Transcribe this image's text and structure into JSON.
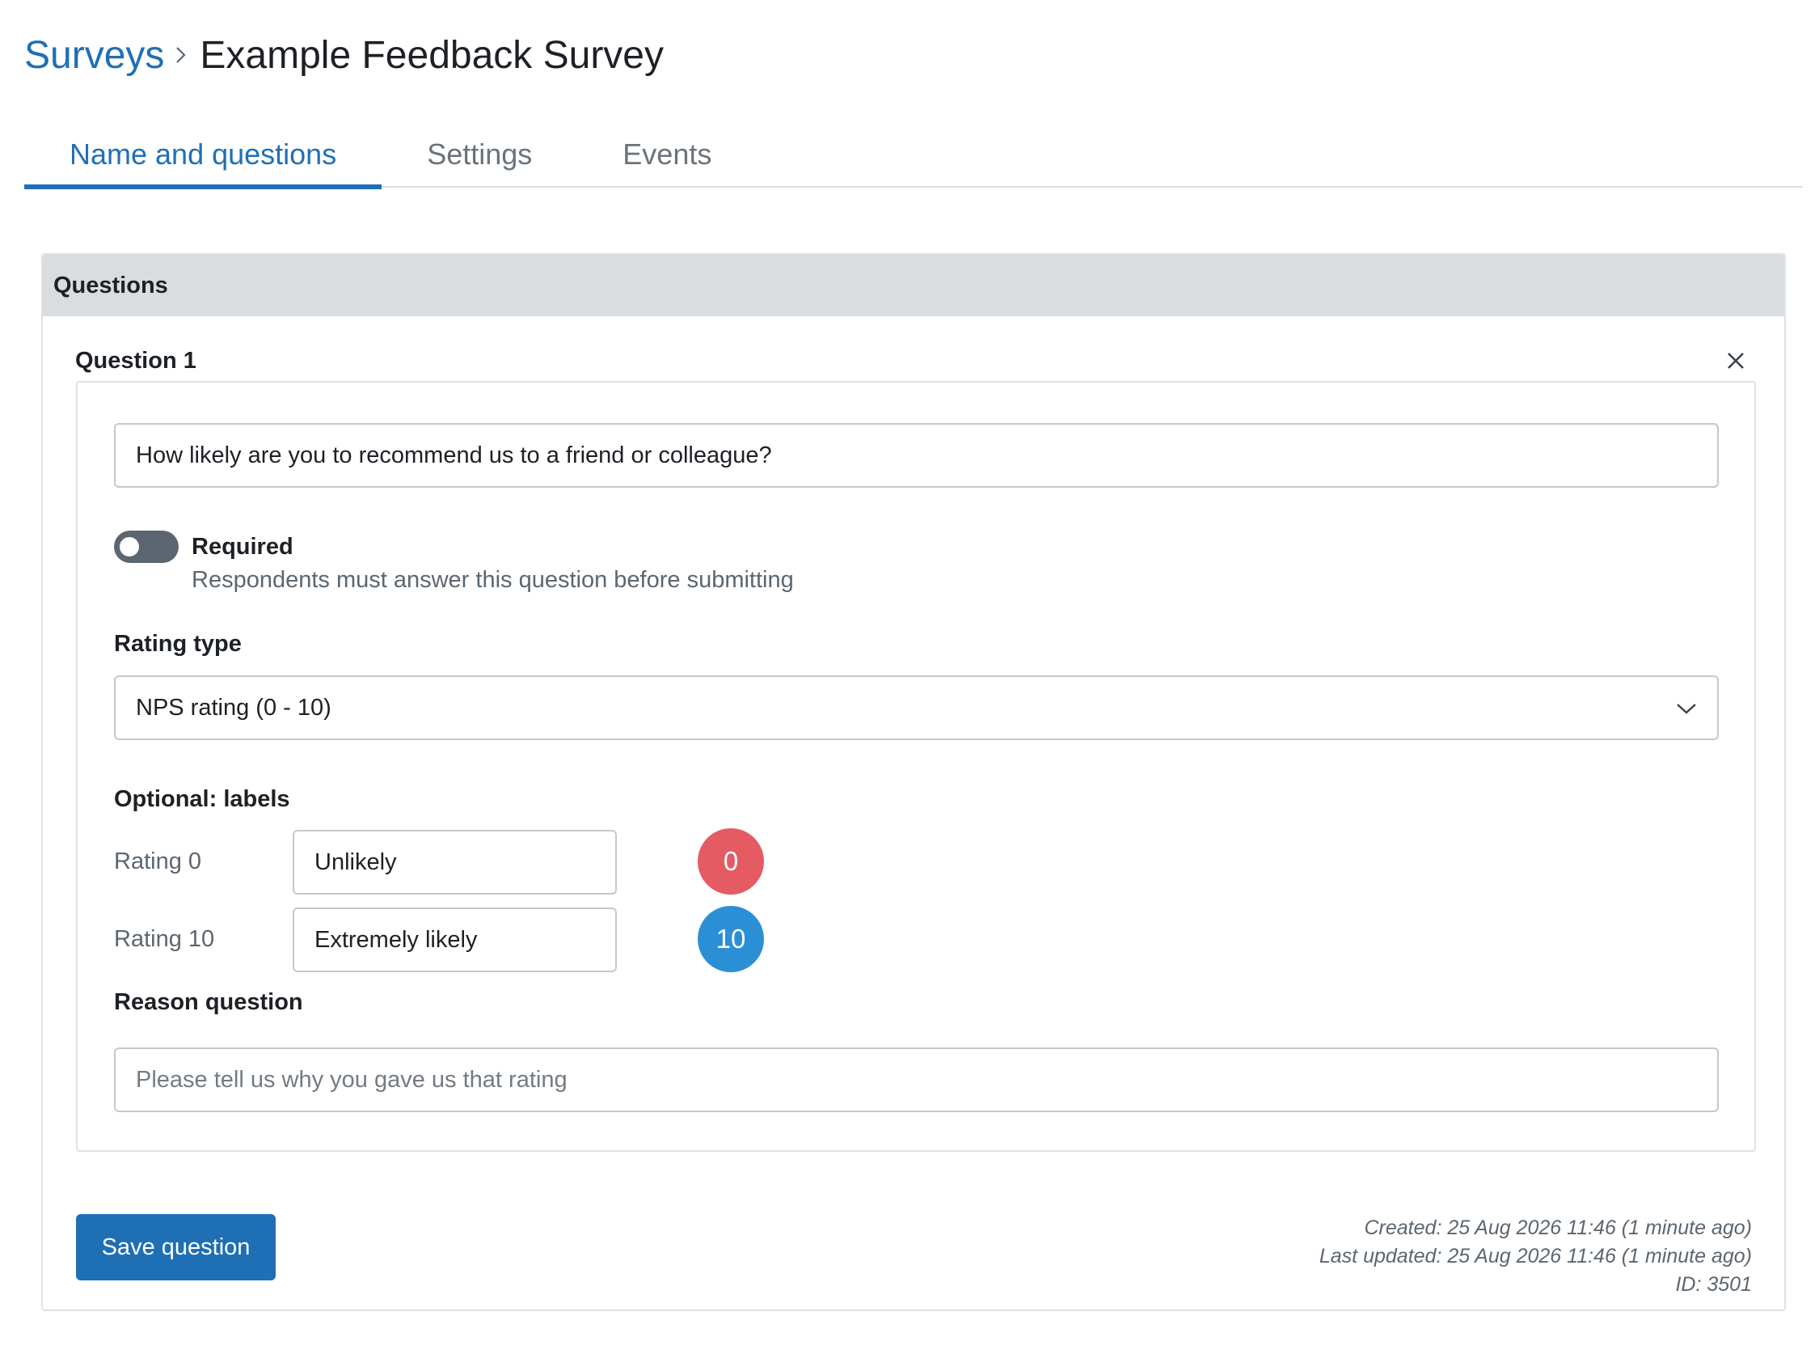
{
  "breadcrumb": {
    "parent": "Surveys",
    "current": "Example Feedback Survey"
  },
  "tabs": [
    {
      "label": "Name and questions",
      "active": true
    },
    {
      "label": "Settings",
      "active": false
    },
    {
      "label": "Events",
      "active": false
    }
  ],
  "questions_section": {
    "header": "Questions",
    "question": {
      "title": "Question 1",
      "text_value": "How likely are you to recommend us to a friend or colleague?",
      "required": {
        "label": "Required",
        "help": "Respondents must answer this question before submitting",
        "on": false
      },
      "rating_type": {
        "label": "Rating type",
        "selected": "NPS rating (0 - 10)"
      },
      "labels": {
        "heading": "Optional: labels",
        "rows": [
          {
            "label": "Rating 0",
            "value": "Unlikely",
            "badge": "0",
            "badge_color": "#e45b64"
          },
          {
            "label": "Rating 10",
            "value": "Extremely likely",
            "badge": "10",
            "badge_color": "#2b8fd6"
          }
        ]
      },
      "reason_question": {
        "label": "Reason question",
        "placeholder": "Please tell us why you gave us that rating"
      }
    },
    "save_label": "Save question",
    "meta": {
      "created": "Created: 25 Aug 2026 11:46 (1 minute ago)",
      "updated": "Last updated: 25 Aug 2026 11:46 (1 minute ago)",
      "id": "ID: 3501"
    }
  },
  "colors": {
    "primary": "#1f6fb5",
    "header_bg": "#dadde0",
    "toggle_off": "#5b6670"
  }
}
